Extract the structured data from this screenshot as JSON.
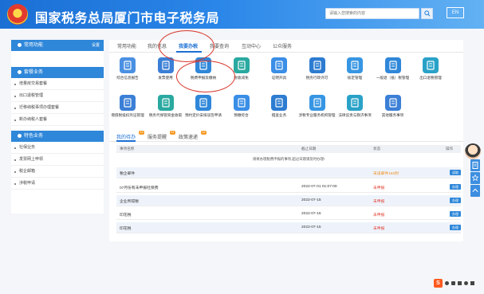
{
  "header": {
    "title": "国家税务总局厦门市电子税务局",
    "search_placeholder": "请输入您搜索的内容",
    "lang_label": "EN"
  },
  "sidebar": {
    "common_title": "常用功能",
    "common_action": "设置",
    "sections": [
      {
        "title": "套餐业务",
        "items": [
          "增量房交易套餐",
          "出口退税管理",
          "迁移纳税事项办理套餐",
          "新办纳税人套餐"
        ]
      },
      {
        "title": "特色业务",
        "items": [
          "社保业务",
          "发票网上申领",
          "税企邮箱",
          "涉税申请"
        ]
      }
    ]
  },
  "tabs": [
    "常用功能",
    "我的信息",
    "我要办税",
    "我要查询",
    "互动中心",
    "公众服务"
  ],
  "functions": [
    {
      "label": "综合信息报告",
      "color": "#4a90e2"
    },
    {
      "label": "发票使用",
      "color": "#3b7fd6"
    },
    {
      "label": "税费申报及缴纳",
      "color": "#2f87d9"
    },
    {
      "label": "税收减免",
      "color": "#2aa9a0"
    },
    {
      "label": "证明开具",
      "color": "#3a8ee6"
    },
    {
      "label": "税务行政许可",
      "color": "#2d7cd1"
    },
    {
      "label": "核定管理",
      "color": "#3796e3"
    },
    {
      "label": "一般退（抵）税管理",
      "color": "#2f87d9"
    },
    {
      "label": "出口退税管理",
      "color": "#2aa2c8"
    },
    {
      "label": "增值税抵扣凭证管理",
      "color": "#3b7fd6"
    },
    {
      "label": "税务代保管资金收取",
      "color": "#2aa9a0"
    },
    {
      "label": "预约定价安排谈签申请",
      "color": "#2f87d9"
    },
    {
      "label": "预缴综合",
      "color": "#3a8ee6"
    },
    {
      "label": "稽查业务",
      "color": "#2d7cd1"
    },
    {
      "label": "涉税专业服务机构管理",
      "color": "#3796e3"
    },
    {
      "label": "法律追责与救济事项",
      "color": "#2aa2c8"
    },
    {
      "label": "其他服务事项",
      "color": "#3b7fd6"
    }
  ],
  "sub_tabs": [
    {
      "label": "我的待办",
      "badge": "12"
    },
    {
      "label": "服务提醒",
      "badge": "12"
    },
    {
      "label": "政策速递",
      "badge": "12"
    }
  ],
  "table": {
    "headers": [
      "事项名称",
      "截止日期",
      "状态",
      "操作"
    ],
    "notice": "请将办理税费申报的事项,超过日期请及时办理!",
    "rows": [
      {
        "name": "税企邮件",
        "date": "",
        "status": "未读邮件183封",
        "action": "读取"
      },
      {
        "name": "07月份有未申报社保费",
        "date": "2022-07-01 01:07:00",
        "status": "未申报",
        "action": "办理"
      },
      {
        "name": "企业所得税",
        "date": "2022-07-15",
        "status": "未申报",
        "action": "办理"
      },
      {
        "name": "印花税",
        "date": "2022-07-15",
        "status": "未申报",
        "action": "办理"
      },
      {
        "name": "印花税",
        "date": "2022-07-15",
        "status": "未申报",
        "action": "办理"
      }
    ]
  },
  "ime": {
    "label": "S"
  },
  "colors": {
    "primary": "#1a6fd3",
    "annotation": "#d9352b",
    "status_red": "#e23b2e"
  }
}
